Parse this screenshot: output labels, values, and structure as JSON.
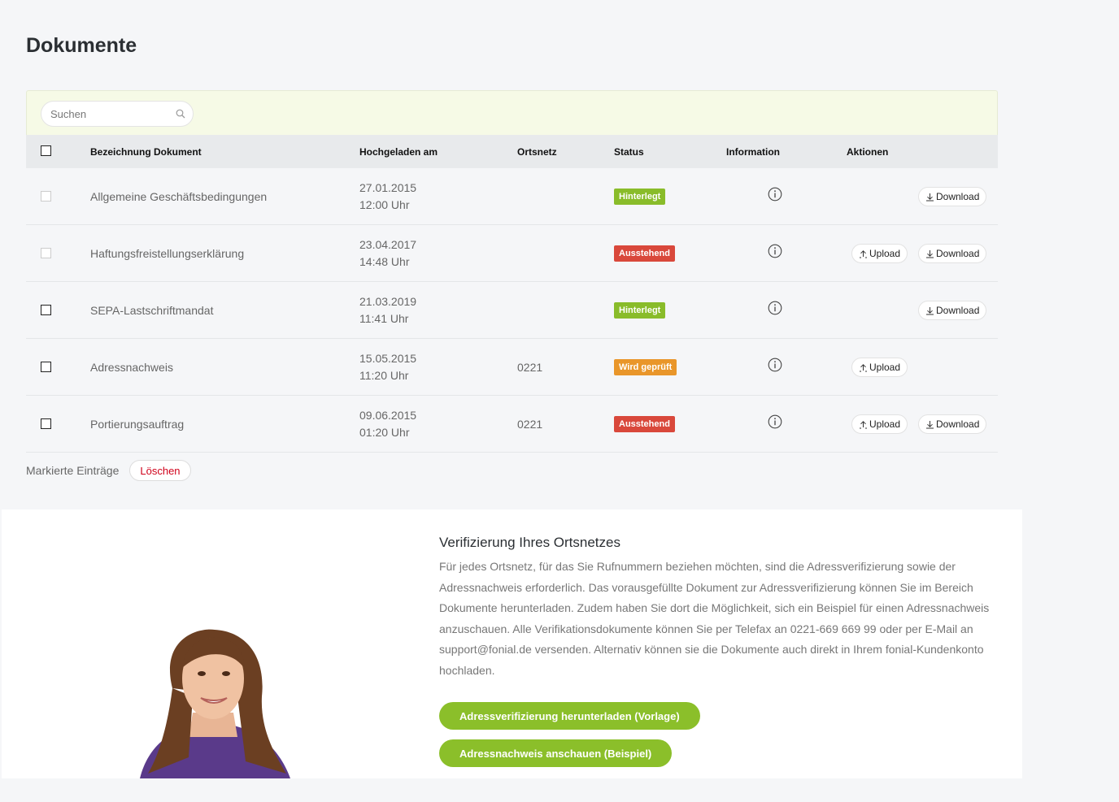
{
  "page": {
    "title": "Dokumente"
  },
  "search": {
    "placeholder": "Suchen"
  },
  "table": {
    "headers": {
      "name": "Bezeichnung Dokument",
      "uploaded": "Hochgeladen am",
      "ortsnetz": "Ortsnetz",
      "status": "Status",
      "information": "Information",
      "actions": "Aktionen"
    },
    "rows": [
      {
        "name": "Allgemeine Geschäftsbedingungen",
        "date": "27.01.2015",
        "time": "12:00 Uhr",
        "ortsnetz": "",
        "status": "Hinterlegt",
        "status_color": "#89bc2a",
        "upload": "",
        "download": "Download"
      },
      {
        "name": "Haftungsfreistellungserklärung",
        "date": "23.04.2017",
        "time": "14:48 Uhr",
        "ortsnetz": "",
        "status": "Ausstehend",
        "status_color": "#d9483b",
        "upload": "Upload",
        "download": "Download"
      },
      {
        "name": "SEPA-Lastschriftmandat",
        "date": "21.03.2019",
        "time": "11:41 Uhr",
        "ortsnetz": "",
        "status": "Hinterlegt",
        "status_color": "#89bc2a",
        "upload": "",
        "download": "Download"
      },
      {
        "name": "Adressnachweis",
        "date": "15.05.2015",
        "time": "11:20 Uhr",
        "ortsnetz": "0221",
        "status": "Wird geprüft",
        "status_color": "#e9962a",
        "upload": "Upload",
        "download": ""
      },
      {
        "name": "Portierungsauftrag",
        "date": "09.06.2015",
        "time": "01:20 Uhr",
        "ortsnetz": "0221",
        "status": "Ausstehend",
        "status_color": "#d9483b",
        "upload": "Upload",
        "download": "Download"
      }
    ]
  },
  "bulk": {
    "label": "Markierte Einträge",
    "delete_label": "Löschen"
  },
  "verification": {
    "title": "Verifizierung Ihres Ortsnetzes",
    "text": "Für jedes Ortsnetz, für das Sie Rufnummern beziehen möchten, sind die Adressverifizierung sowie der Adressnachweis erforderlich. Das vorausgefüllte Dokument zur Adressverifizierung können Sie im Bereich Dokumente herunterladen. Zudem haben Sie dort die Möglichkeit, sich ein Beispiel für einen Adressnachweis anzuschauen. Alle Verifikationsdokumente können Sie per Telefax an 0221-669 669 99 oder per E-Mail an support@fonial.de versenden. Alternativ können sie die Dokumente auch direkt in Ihrem fonial-Kundenkonto hochladen.",
    "button_template": "Adressverifizierung herunterladen (Vorlage)",
    "button_example": "Adressnachweis anschauen (Beispiel)"
  },
  "colors": {
    "accent": "#8bbf2a",
    "search_bg": "#f6fae6",
    "header_bg": "#e8eaec",
    "danger": "#d0021b"
  }
}
